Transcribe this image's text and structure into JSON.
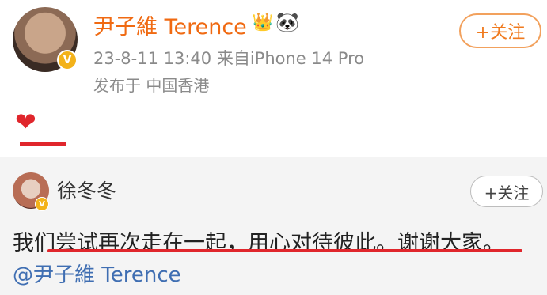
{
  "post": {
    "username": "尹子維 Terence",
    "meta": "23-8-11 13:40  来自iPhone 14 Pro",
    "location": "发布于 中国香港",
    "follow_label": "+关注",
    "content_emoji": "❤",
    "badge_icon": "crown-icon",
    "badge_icon2": "panda-icon",
    "verified_mark": "V"
  },
  "repost": {
    "username": "徐冬冬",
    "follow_label": "+关注",
    "text": "我们尝试再次走在一起，用心对待彼此。谢谢大家。",
    "mention": "@尹子維 Terence",
    "verified_mark": "V"
  },
  "colors": {
    "accent_orange": "#f06a12",
    "underline_red": "#e0262c",
    "link_blue": "#3f6eb2",
    "card_bg": "#f4f4f4"
  }
}
